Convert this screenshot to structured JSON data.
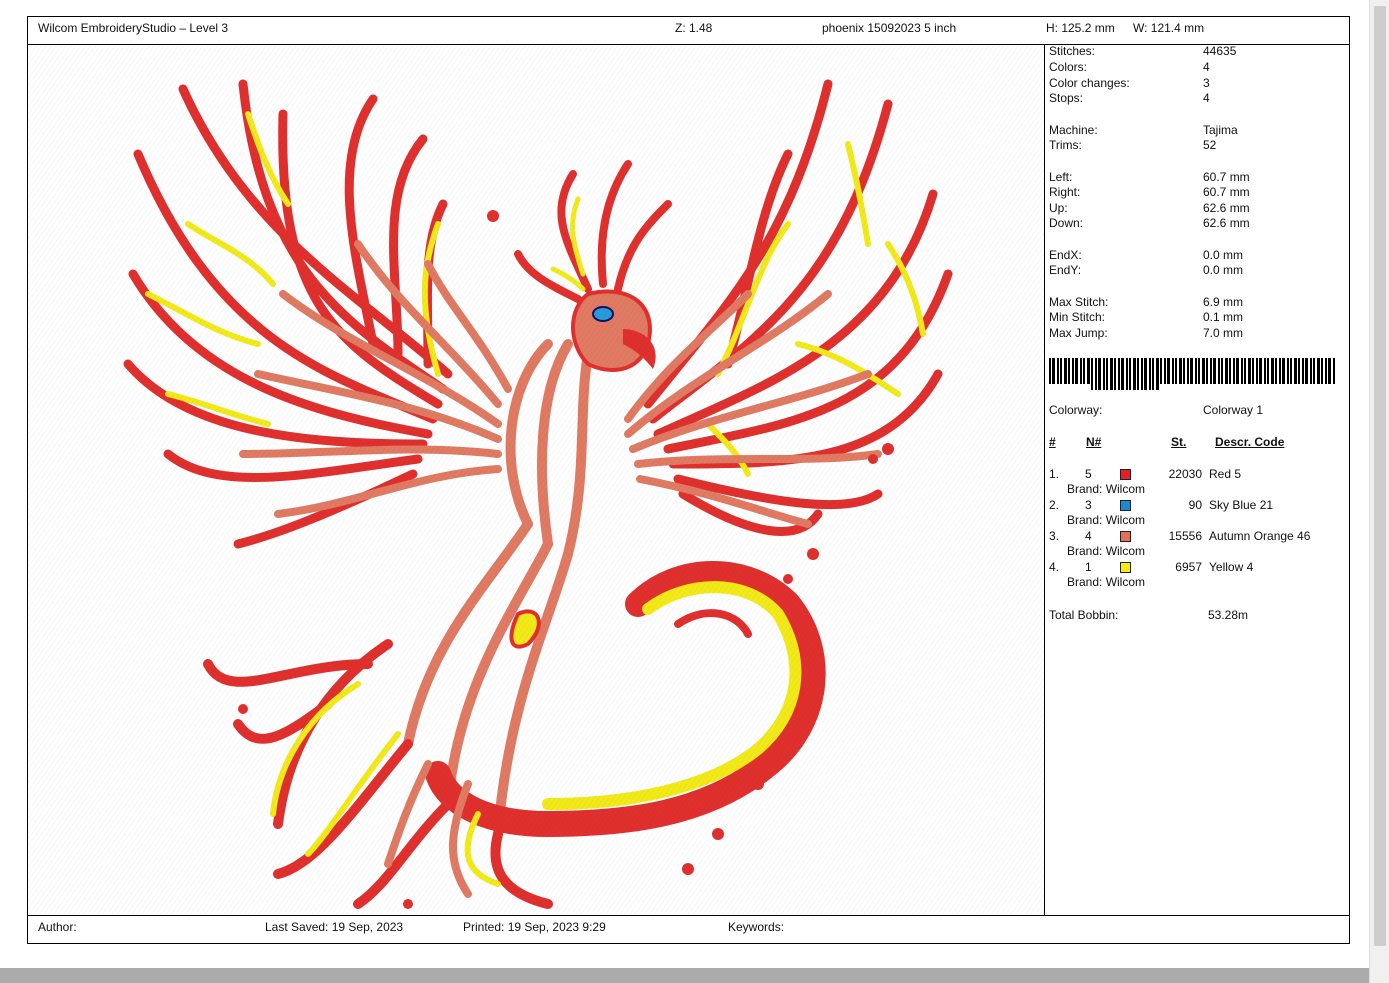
{
  "header": {
    "app_title": "Wilcom EmbroideryStudio – Level 3",
    "zoom": "Z:  1.48",
    "design_name": "phoenix 15092023 5 inch",
    "height": "H: 125.2 mm",
    "width": "W:  121.4 mm"
  },
  "stats": [
    {
      "label": "Stitches:",
      "value": "44635"
    },
    {
      "label": "Colors:",
      "value": "4"
    },
    {
      "label": "Color changes:",
      "value": "3"
    },
    {
      "label": "Stops:",
      "value": "4"
    },
    {
      "label": "Machine:",
      "value": "Tajima"
    },
    {
      "label": "Trims:",
      "value": "52"
    },
    {
      "label": "Left:",
      "value": "60.7 mm"
    },
    {
      "label": "Right:",
      "value": "60.7 mm"
    },
    {
      "label": "Up:",
      "value": "62.6 mm"
    },
    {
      "label": "Down:",
      "value": "62.6 mm"
    },
    {
      "label": "EndX:",
      "value": "0.0 mm"
    },
    {
      "label": "EndY:",
      "value": "0.0 mm"
    },
    {
      "label": "Max Stitch:",
      "value": "6.9 mm"
    },
    {
      "label": "Min Stitch:",
      "value": "0.1 mm"
    },
    {
      "label": "Max Jump:",
      "value": "7.0 mm"
    }
  ],
  "colorway": {
    "label": "Colorway:",
    "value": "Colorway 1"
  },
  "color_table": {
    "headers": {
      "index": "#",
      "needle": "N#",
      "stitches": "St.",
      "descr": "Descr. Code"
    },
    "rows": [
      {
        "index": "1.",
        "needle": "5",
        "color": "#e0202a",
        "stitches": "22030",
        "descr": "Red 5",
        "brand": "Brand: Wilcom"
      },
      {
        "index": "2.",
        "needle": "3",
        "color": "#1e88d0",
        "stitches": "90",
        "descr": "Sky Blue 21",
        "brand": "Brand: Wilcom"
      },
      {
        "index": "3.",
        "needle": "4",
        "color": "#e2705c",
        "stitches": "15556",
        "descr": "Autumn Orange 46",
        "brand": "Brand: Wilcom"
      },
      {
        "index": "4.",
        "needle": "1",
        "color": "#f2ec10",
        "stitches": "6957",
        "descr": "Yellow 4",
        "brand": "Brand: Wilcom"
      }
    ],
    "total_label": "Total Bobbin:",
    "total_value": "53.28m"
  },
  "footer": {
    "author": "Author:",
    "last_saved": "Last Saved: 19 Sep, 2023",
    "printed": "Printed: 19 Sep, 2023  9:29",
    "keywords": "Keywords:"
  },
  "colors": {
    "red": "#e0302e",
    "salmon": "#e07a62",
    "yellow": "#f2ea18",
    "blue": "#2a9ad8"
  }
}
